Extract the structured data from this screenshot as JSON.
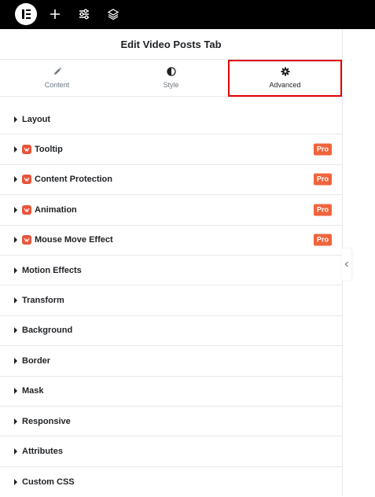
{
  "topbar": {
    "icons": [
      "elementor-logo-icon",
      "plus-icon",
      "sliders-icon",
      "layers-icon"
    ]
  },
  "panel": {
    "title": "Edit Video Posts Tab",
    "tabs": [
      {
        "label": "Content",
        "icon": "pencil-icon",
        "active": false
      },
      {
        "label": "Style",
        "icon": "half-circle-icon",
        "active": false
      },
      {
        "label": "Advanced",
        "icon": "gear-icon",
        "active": true
      }
    ],
    "sections": [
      {
        "label": "Layout",
        "pro": false
      },
      {
        "label": "Tooltip",
        "pro": true,
        "badge": "Pro"
      },
      {
        "label": "Content Protection",
        "pro": true,
        "badge": "Pro"
      },
      {
        "label": "Animation",
        "pro": true,
        "badge": "Pro"
      },
      {
        "label": "Mouse Move Effect",
        "pro": true,
        "badge": "Pro"
      },
      {
        "label": "Motion Effects",
        "pro": false
      },
      {
        "label": "Transform",
        "pro": false
      },
      {
        "label": "Background",
        "pro": false
      },
      {
        "label": "Border",
        "pro": false
      },
      {
        "label": "Mask",
        "pro": false
      },
      {
        "label": "Responsive",
        "pro": false
      },
      {
        "label": "Attributes",
        "pro": false
      },
      {
        "label": "Custom CSS",
        "pro": false
      }
    ]
  },
  "colors": {
    "topbar": "#000000",
    "accent_highlight": "#e00000",
    "pro_badge": "#f0643c",
    "pro_icon": "#e8553a"
  }
}
